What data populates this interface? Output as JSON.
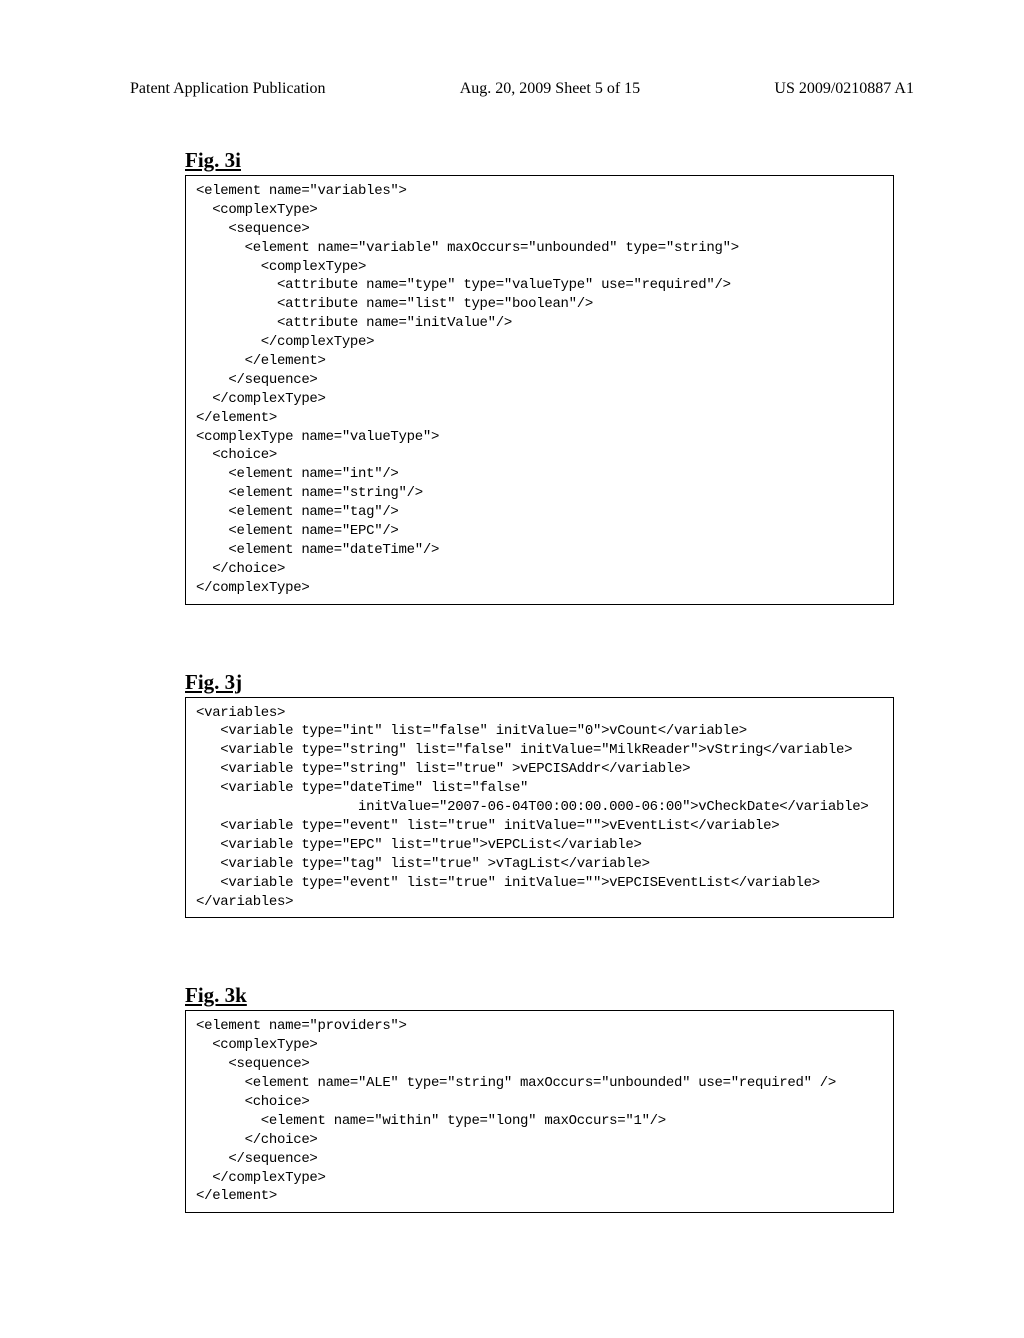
{
  "header": {
    "left": "Patent Application Publication",
    "center": "Aug. 20, 2009  Sheet 5 of 15",
    "right": "US 2009/0210887 A1"
  },
  "figures": [
    {
      "title": "Fig. 3i",
      "code": "<element name=\"variables\">\n  <complexType>\n    <sequence>\n      <element name=\"variable\" maxOccurs=\"unbounded\" type=\"string\">\n        <complexType>\n          <attribute name=\"type\" type=\"valueType\" use=\"required\"/>\n          <attribute name=\"list\" type=\"boolean\"/>\n          <attribute name=\"initValue\"/>\n        </complexType>\n      </element>\n    </sequence>\n  </complexType>\n</element>\n<complexType name=\"valueType\">\n  <choice>\n    <element name=\"int\"/>\n    <element name=\"string\"/>\n    <element name=\"tag\"/>\n    <element name=\"EPC\"/>\n    <element name=\"dateTime\"/>\n  </choice>\n</complexType>"
    },
    {
      "title": "Fig. 3j",
      "code": "<variables>\n   <variable type=\"int\" list=\"false\" initValue=\"0\">vCount</variable>\n   <variable type=\"string\" list=\"false\" initValue=\"MilkReader\">vString</variable>\n   <variable type=\"string\" list=\"true\" >vEPCISAddr</variable>\n   <variable type=\"dateTime\" list=\"false\"\n                    initValue=\"2007-06-04T00:00:00.000-06:00\">vCheckDate</variable>\n   <variable type=\"event\" list=\"true\" initValue=\"\">vEventList</variable>\n   <variable type=\"EPC\" list=\"true\">vEPCList</variable>\n   <variable type=\"tag\" list=\"true\" >vTagList</variable>\n   <variable type=\"event\" list=\"true\" initValue=\"\">vEPCISEventList</variable>\n</variables>"
    },
    {
      "title": "Fig. 3k",
      "code": "<element name=\"providers\">\n  <complexType>\n    <sequence>\n      <element name=\"ALE\" type=\"string\" maxOccurs=\"unbounded\" use=\"required\" />\n      <choice>\n        <element name=\"within\" type=\"long\" maxOccurs=\"1\"/>\n      </choice>\n    </sequence>\n  </complexType>\n</element>"
    }
  ]
}
